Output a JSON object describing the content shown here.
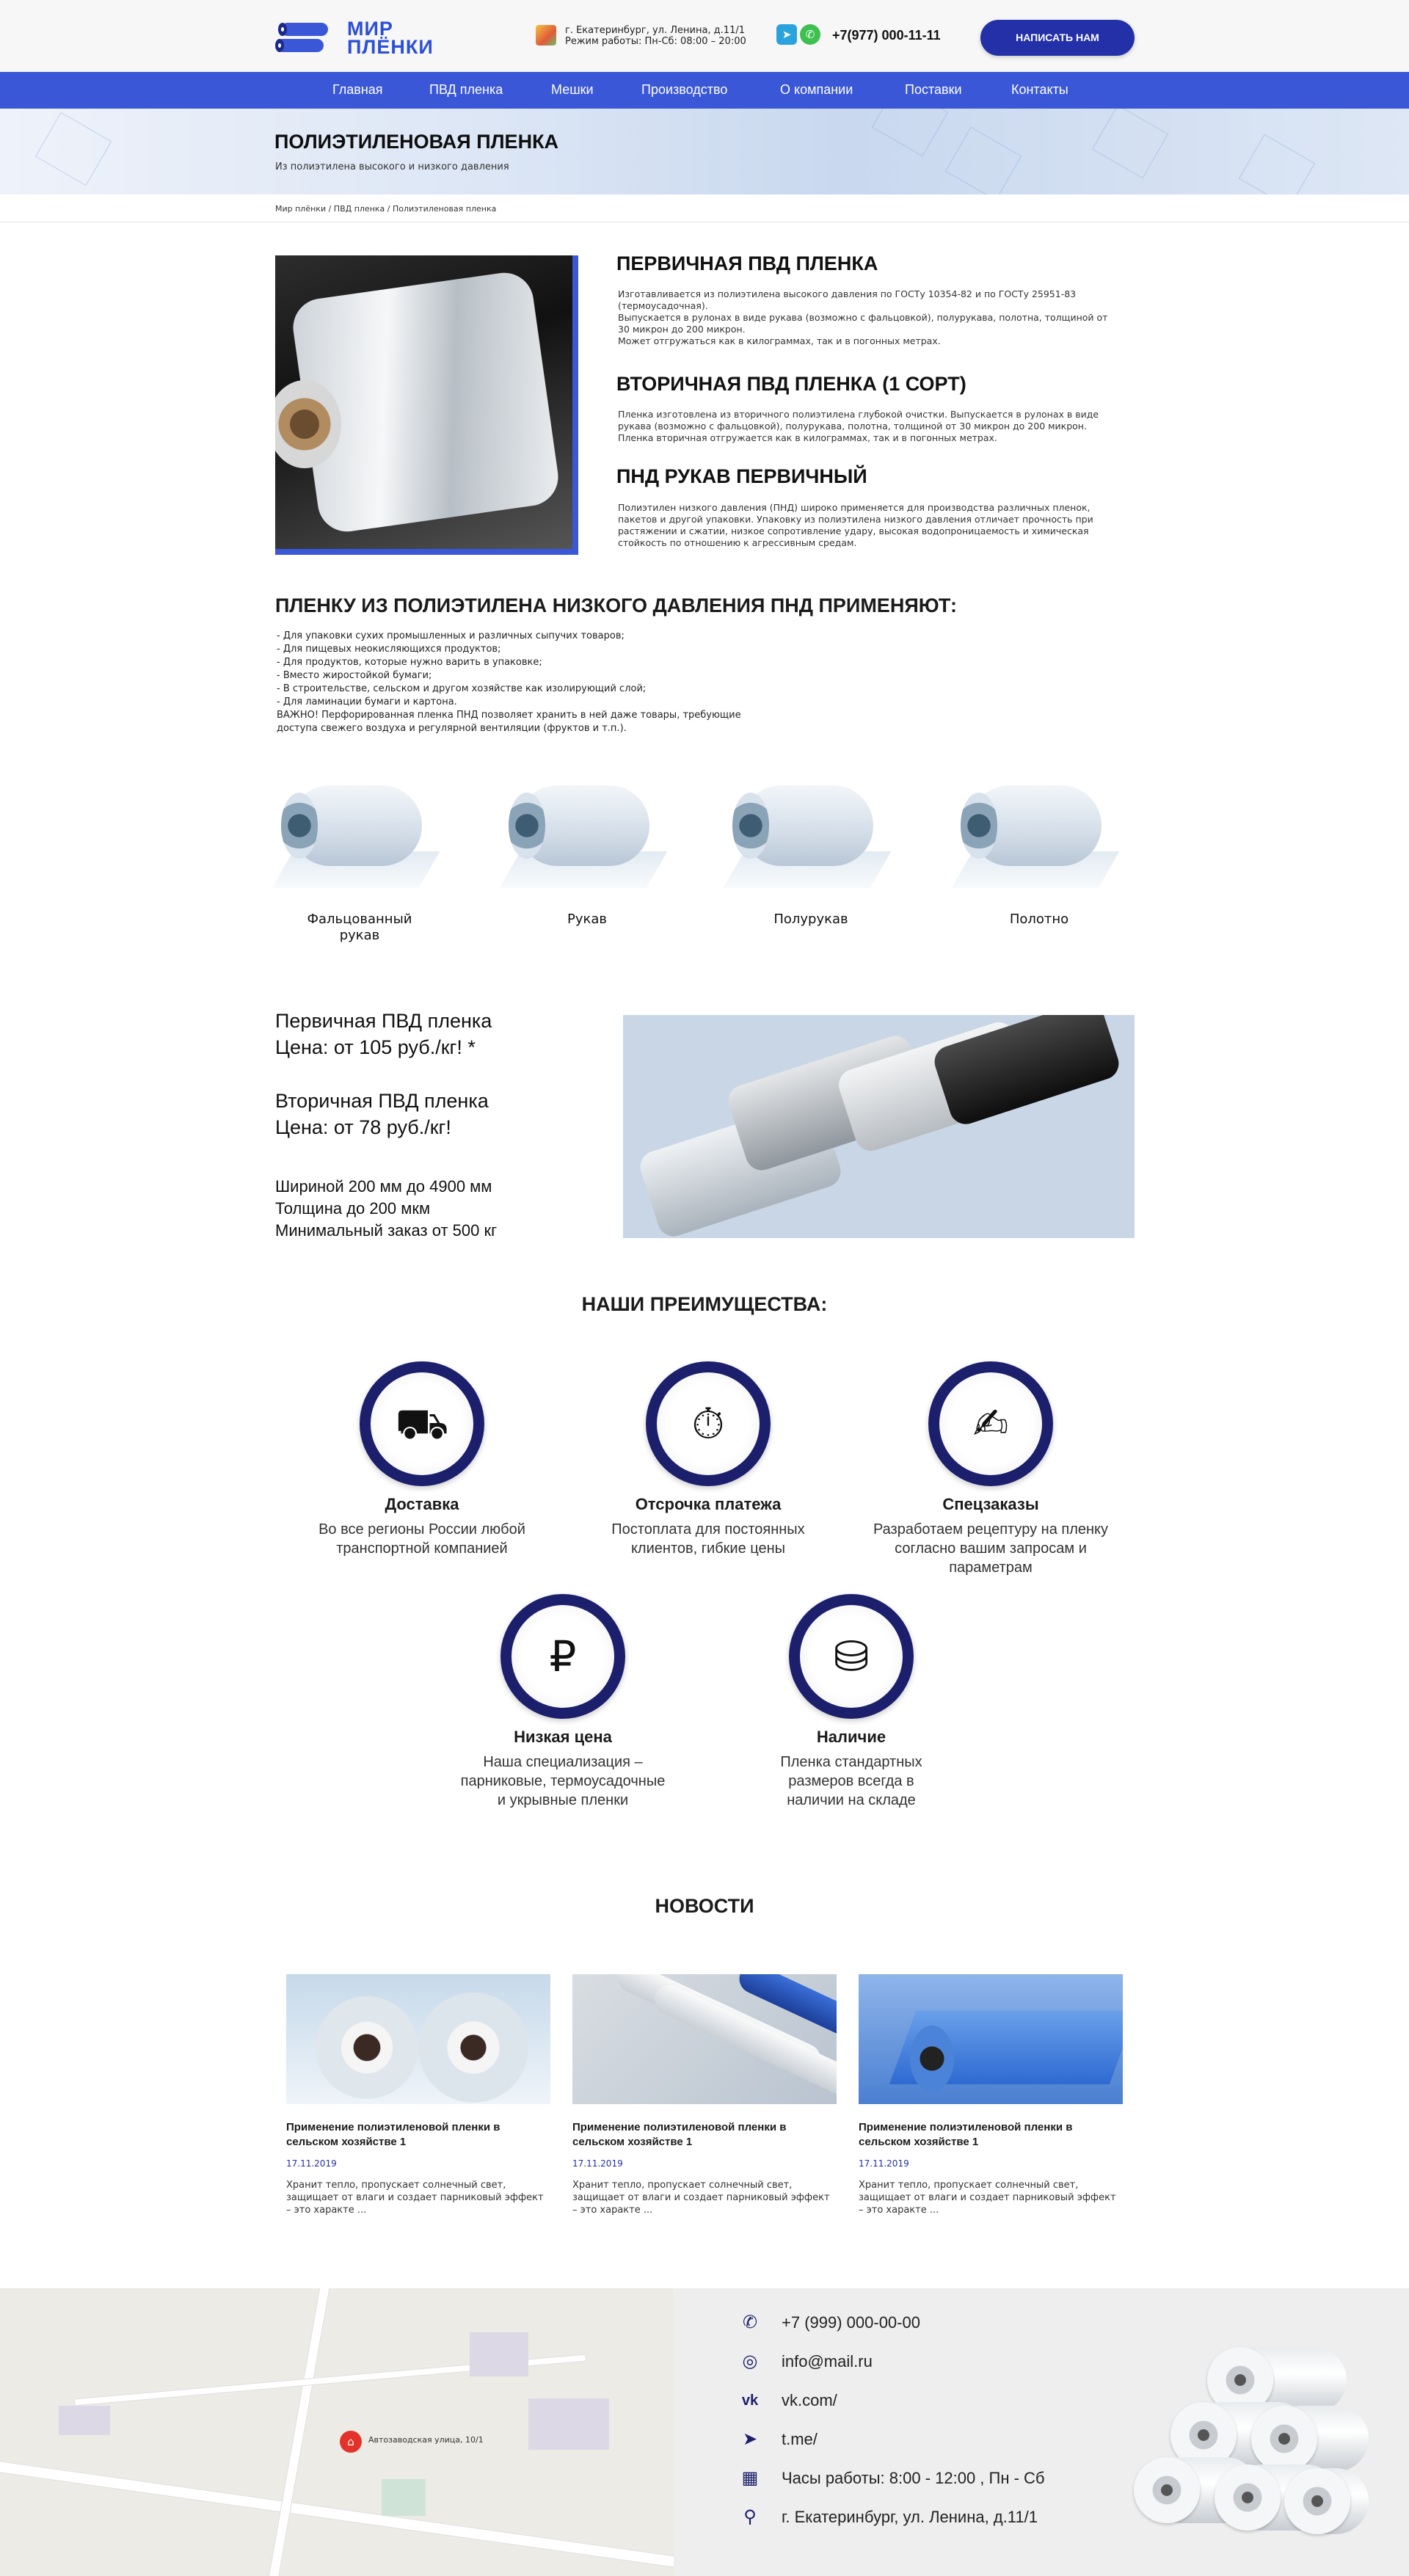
{
  "header": {
    "logo_line1": "МИР",
    "logo_line2": "ПЛЁНКИ",
    "address": "г. Екатеринбург, ул. Ленина, д.11/1",
    "hours": "Режим работы: Пн-Сб: 08:00 – 20:00",
    "phone": "+7(977) 000-11-11",
    "cta": "НАПИСАТЬ НАМ",
    "telegram_icon": "telegram-icon",
    "whatsapp_icon": "whatsapp-icon"
  },
  "nav": {
    "items": [
      "Главная",
      "ПВД пленка",
      "Мешки",
      "Производство",
      "О компании",
      "Поставки",
      "Контакты"
    ]
  },
  "banner": {
    "title": "ПОЛИЭТИЛЕНОВАЯ ПЛЕНКА",
    "subtitle": "Из полиэтилена высокого и низкого давления"
  },
  "breadcrumb": "Мир плёнки / ПВД пленка / Полиэтиленовая пленка",
  "sections": [
    {
      "title": "ПЕРВИЧНАЯ ПВД ПЛЕНКА",
      "text": "Изготавливается из полиэтилена высокого давления по ГОСТу 10354-82 и по ГОСТу 25951-83\n(термоусадочная).\nВыпускается в рулонах в виде рукава (возможно с фальцовкой), полурукава, полотна, толщиной от\n30 микрон до 200 микрон.\nМожет отгружаться как в килограммах, так и в погонных метрах."
    },
    {
      "title": "ВТОРИЧНАЯ ПВД ПЛЕНКА (1 СОРТ)",
      "text": "Пленка изготовлена из вторичного полиэтилена глубокой очистки. Выпускается в рулонах в виде\nрукава (возможно с фальцовкой), полурукава, полотна, толщиной от 30 микрон до 200 микрон.\nПленка вторичная отгружается как в килограммах, так и в погонных метрах."
    },
    {
      "title": "ПНД РУКАВ ПЕРВИЧНЫЙ",
      "text": "Полиэтилен низкого давления (ПНД) широко применяется для производства различных пленок,\nпакетов и другой упаковки. Упаковку из полиэтилена низкого давления отличает прочность при\nрастяжении и сжатии, низкое сопротивление удару, высокая водопроницаемость и химическая\nстойкость по отношению к агрессивным средам."
    }
  ],
  "usage": {
    "title": "ПЛЕНКУ ИЗ ПОЛИЭТИЛЕНА НИЗКОГО ДАВЛЕНИЯ ПНД ПРИМЕНЯЮТ:",
    "items": [
      "- Для упаковки сухих промышленных и различных сыпучих товаров;",
      "- Для пищевых неокисляющихся продуктов;",
      "- Для продуктов, которые нужно варить в упаковке;",
      "- Вместо жиростойкой бумаги;",
      "- В строительстве, сельском и другом хозяйстве как изолирующий слой;",
      "- Для ламинации бумаги и картона.",
      "ВАЖНО! Перфорированная пленка ПНД позволяет хранить в ней даже товары, требующие",
      "доступа свежего воздуха и регулярной вентиляции (фруктов и т.п.)."
    ]
  },
  "variants": [
    "Фальцованный рукав",
    "Рукав",
    "Полурукав",
    "Полотно"
  ],
  "prices": {
    "primary_name": "Первичная ПВД пленка",
    "primary_price": "Цена: от 105 руб./кг! *",
    "secondary_name": "Вторичная ПВД пленка",
    "secondary_price": "Цена: от 78 руб./кг!",
    "width": "Шириной 200 мм до 4900 мм",
    "thickness": "Толщина до 200 мкм",
    "min_order": "Минимальный заказ от 500 кг"
  },
  "advantages": {
    "title": "НАШИ ПРЕИМУЩЕСТВА:",
    "items": [
      {
        "name": "Доставка",
        "desc": "Во все регионы России любой транспортной компанией",
        "icon": "delivery-icon"
      },
      {
        "name": "Отсрочка платежа",
        "desc": "Постоплата для постоянных клиентов, гибкие цены",
        "icon": "stopwatch-icon"
      },
      {
        "name": "Спецзаказы",
        "desc": "Разработаем рецептуру на пленку согласно вашим запросам и параметрам",
        "icon": "handshake-icon"
      },
      {
        "name": "Низкая цена",
        "desc": "Наша специализация – парниковые, термоусадочные и укрывные пленки",
        "icon": "price-icon"
      },
      {
        "name": "Наличие",
        "desc": "Пленка стандартных размеров всегда в наличии на складе",
        "icon": "rolls-icon"
      }
    ]
  },
  "news": {
    "title": "НОВОСТИ",
    "items": [
      {
        "title": "Применение полиэтиленовой пленки в сельском хозяйстве 1",
        "date": "17.11.2019",
        "text": "Хранит тепло, пропускает солнечный свет, защищает от влаги и создает парниковый эффект – это характе ..."
      },
      {
        "title": "Применение полиэтиленовой пленки в сельском хозяйстве 1",
        "date": "17.11.2019",
        "text": "Хранит тепло, пропускает солнечный свет, защищает от влаги и создает парниковый эффект – это характе ..."
      },
      {
        "title": "Применение полиэтиленовой пленки в сельском хозяйстве 1",
        "date": "17.11.2019",
        "text": "Хранит тепло, пропускает солнечный свет, защищает от влаги и создает парниковый эффект – это характе ..."
      }
    ]
  },
  "footer": {
    "map_label": "Автозаводская улица, 10/1",
    "contacts": [
      {
        "icon": "whatsapp-icon",
        "text": "+7 (999) 000-00-00"
      },
      {
        "icon": "instagram-icon",
        "text": "info@mail.ru"
      },
      {
        "icon": "vk-icon",
        "text": "vk.com/"
      },
      {
        "icon": "telegram-icon",
        "text": "t.me/"
      },
      {
        "icon": "calendar-icon",
        "text": "Часы работы: 8:00 - 12:00 , Пн - Сб"
      },
      {
        "icon": "location-icon",
        "text": "г. Екатеринбург, ул. Ленина, д.11/1"
      }
    ]
  },
  "colors": {
    "accent": "#3a57d8",
    "dark_blue": "#1b1f6c",
    "button": "#2330a8"
  }
}
